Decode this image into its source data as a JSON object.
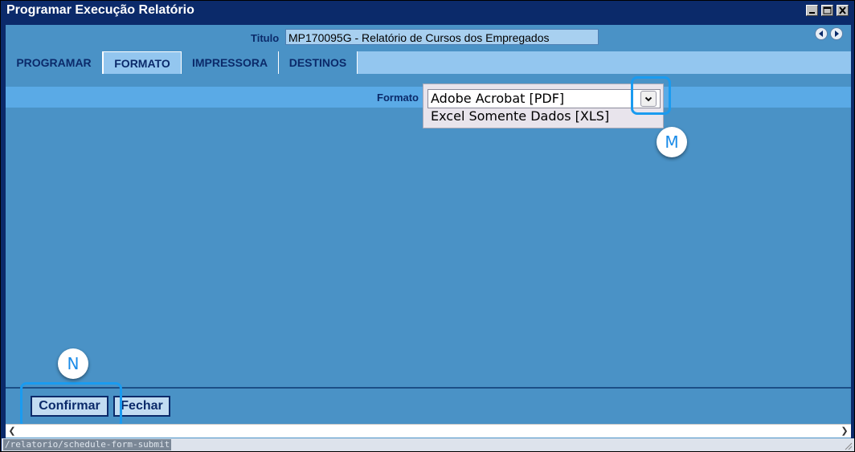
{
  "window": {
    "title": "Programar Execução Relatório",
    "controls": [
      "minimize-icon",
      "maximize-icon",
      "close-icon"
    ]
  },
  "header": {
    "titulo_label": "Titulo",
    "titulo_value": "MP170095G - Relatório de Cursos dos Empregados",
    "nav_icons": [
      "prev-arrow-icon",
      "next-arrow-icon"
    ]
  },
  "tabs": [
    {
      "label": "PROGRAMAR",
      "active": false
    },
    {
      "label": "FORMATO",
      "active": true
    },
    {
      "label": "IMPRESSORA",
      "active": false
    },
    {
      "label": "DESTINOS",
      "active": false
    }
  ],
  "formato": {
    "label": "Formato",
    "selected": "Adobe Acrobat [PDF]",
    "options": [
      "Adobe Acrobat [PDF]",
      "Excel Somente Dados [XLS]"
    ]
  },
  "markers": {
    "m": "M",
    "n": "N"
  },
  "footer": {
    "confirm_label": "Confirmar",
    "close_label": "Fechar"
  },
  "statusbar": {
    "url": "/relatorio/schedule-form-submit"
  },
  "colors": {
    "titlebar": "#0b2a6a",
    "panel": "#4a92c6",
    "tabs_bar": "#93c6ef",
    "format_row": "#5aaae6",
    "highlight": "#1a9bf0"
  }
}
